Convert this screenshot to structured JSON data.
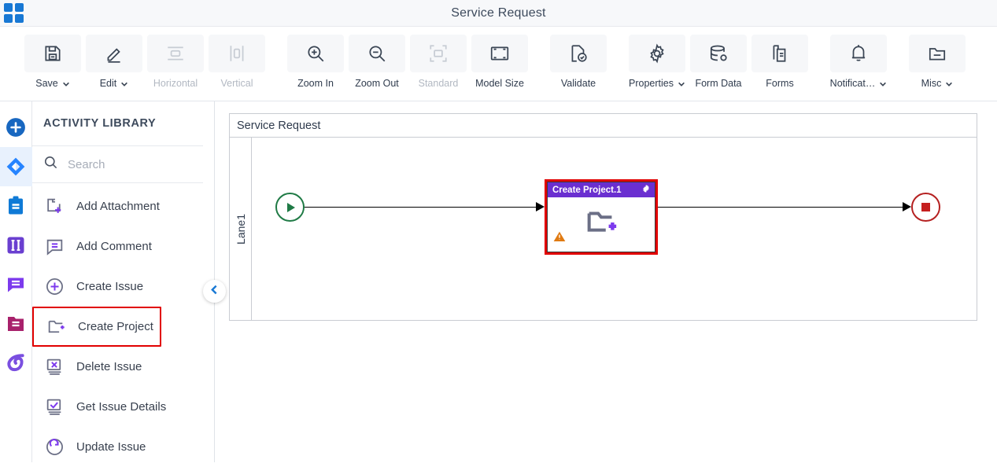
{
  "app": {
    "logo_icon": "grid-apps-icon",
    "title": "Service Request",
    "accent_blue": "#1878d4",
    "selection_red": "#e10000"
  },
  "ribbon": {
    "buttons": [
      {
        "label": "Save",
        "icon": "save-disk-icon",
        "has_caret": true,
        "disabled": false
      },
      {
        "label": "Edit",
        "icon": "pencil-icon",
        "has_caret": true,
        "disabled": false
      },
      {
        "label": "Horizontal",
        "icon": "horizontal-layout-icon",
        "has_caret": false,
        "disabled": true
      },
      {
        "label": "Vertical",
        "icon": "vertical-layout-icon",
        "has_caret": false,
        "disabled": true
      },
      {
        "label": "Zoom In",
        "icon": "zoom-in-icon",
        "has_caret": false,
        "disabled": false
      },
      {
        "label": "Zoom Out",
        "icon": "zoom-out-icon",
        "has_caret": false,
        "disabled": false
      },
      {
        "label": "Standard",
        "icon": "standard-size-icon",
        "has_caret": false,
        "disabled": true
      },
      {
        "label": "Model Size",
        "icon": "model-size-icon",
        "has_caret": false,
        "disabled": false
      },
      {
        "label": "Validate",
        "icon": "validate-check-icon",
        "has_caret": false,
        "disabled": false
      },
      {
        "label": "Properties",
        "icon": "gear-icon",
        "has_caret": true,
        "disabled": false
      },
      {
        "label": "Form Data",
        "icon": "database-icon",
        "has_caret": false,
        "disabled": false
      },
      {
        "label": "Forms",
        "icon": "document-copy-icon",
        "has_caret": false,
        "disabled": false
      },
      {
        "label": "Notificat…",
        "icon": "bell-icon",
        "has_caret": true,
        "disabled": false
      },
      {
        "label": "Misc",
        "icon": "folder-misc-icon",
        "has_caret": false,
        "disabled": false
      }
    ]
  },
  "rail": {
    "items": [
      {
        "name": "add-new-icon",
        "color": "#1867c0",
        "active": false
      },
      {
        "name": "jira-diamond-icon",
        "color": "#2684ff",
        "active": true
      },
      {
        "name": "clipboard-icon",
        "color": "#0f7ad6",
        "active": false
      },
      {
        "name": "columns-icon",
        "color": "#6a3fd0",
        "active": false
      },
      {
        "name": "comment-icon",
        "color": "#7c3aed",
        "active": false
      },
      {
        "name": "folder-magenta-icon",
        "color": "#a8216b",
        "active": false
      },
      {
        "name": "swirl-icon",
        "color": "#7a4fe0",
        "active": false
      }
    ]
  },
  "library": {
    "heading": "ACTIVITY LIBRARY",
    "search": {
      "placeholder": "Search",
      "value": "",
      "icon": "search-icon"
    },
    "collapse_icon": "chevron-left-icon",
    "items": [
      {
        "label": "Add Attachment",
        "icon": "attachment-add-icon",
        "selected": false
      },
      {
        "label": "Add Comment",
        "icon": "comment-add-icon",
        "selected": false
      },
      {
        "label": "Create Issue",
        "icon": "circle-plus-icon",
        "selected": false
      },
      {
        "label": "Create Project",
        "icon": "folder-add-icon",
        "selected": true
      },
      {
        "label": "Delete Issue",
        "icon": "monitor-x-icon",
        "selected": false
      },
      {
        "label": "Get Issue Details",
        "icon": "monitor-check-icon",
        "selected": false
      },
      {
        "label": "Update Issue",
        "icon": "refresh-circle-icon",
        "selected": false
      }
    ]
  },
  "canvas": {
    "pool_title": "Service Request",
    "lane_label": "Lane1",
    "start_node": {
      "name": "start-event",
      "icon": "play-icon",
      "color": "#1f7a45"
    },
    "end_node": {
      "name": "end-event",
      "icon": "stop-square-icon",
      "color": "#c51f1f"
    },
    "task": {
      "title": "Create Project.1",
      "header_color": "#6a2fd0",
      "gear_icon": "gear-icon",
      "body_icon": "folder-add-icon",
      "warning_icon": "warning-triangle-icon",
      "selected": true
    }
  }
}
